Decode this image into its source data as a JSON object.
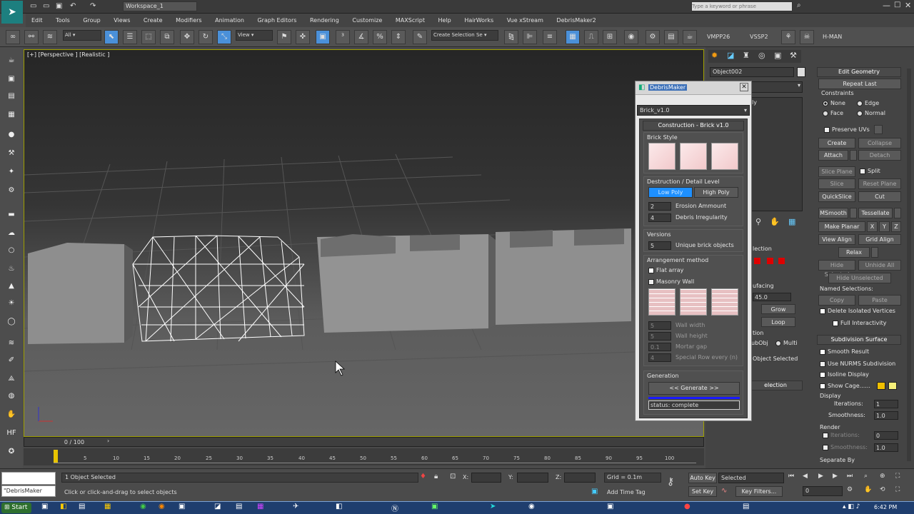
{
  "titlebar": {
    "workspace": "Workspace_1",
    "search_placeholder": "Type a keyword or phrase"
  },
  "menu": [
    "Edit",
    "Tools",
    "Group",
    "Views",
    "Create",
    "Modifiers",
    "Animation",
    "Graph Editors",
    "Rendering",
    "Customize",
    "MAXScript",
    "Help",
    "HairWorks",
    "Vue xStream",
    "DebrisMaker2"
  ],
  "toolbar": {
    "filter": "All",
    "refcoord": "View",
    "selection_set": "Create Selection Se",
    "tools": [
      "VMPP26",
      "VSSP2",
      "H-MAN"
    ]
  },
  "viewport": {
    "label": "[+] [Perspective ] [Realistic ]"
  },
  "timeline": {
    "frame": "0 / 100",
    "ticks": [
      "5",
      "10",
      "15",
      "20",
      "25",
      "30",
      "35",
      "40",
      "45",
      "50",
      "55",
      "60",
      "65",
      "70",
      "75",
      "80",
      "85",
      "90",
      "95",
      "100"
    ]
  },
  "status": {
    "maxscript": "\"DebrisMaker",
    "selected": "1 Object Selected",
    "prompt": "Click or click-and-drag to select objects",
    "x_label": "X:",
    "y_label": "Y:",
    "z_label": "Z:",
    "grid": "Grid = 0.1m",
    "add_time_tag": "Add Time Tag",
    "auto_key": "Auto Key",
    "set_key": "Set Key",
    "selected_drop": "Selected",
    "key_filters": "Key Filters...",
    "frame_value": "0"
  },
  "taskbar": {
    "start": "Start",
    "clock": "6:42 PM"
  },
  "modify_panel": {
    "object_name": "Object002",
    "stack_fragment": "ly",
    "edit_geometry": {
      "title": "Edit Geometry",
      "repeat_last": "Repeat Last",
      "constraints": "Constraints",
      "none": "None",
      "edge": "Edge",
      "face": "Face",
      "normal": "Normal",
      "preserve_uvs": "Preserve UVs",
      "create": "Create",
      "collapse": "Collapse",
      "attach": "Attach",
      "detach": "Detach",
      "slice_plane": "Slice Plane",
      "split": "Split",
      "slice": "Slice",
      "reset_plane": "Reset Plane",
      "quickslice": "QuickSlice",
      "cut": "Cut",
      "msmooth": "MSmooth",
      "tessellate": "Tessellate",
      "make_planar": "Make Planar",
      "x": "X",
      "y": "Y",
      "z": "Z",
      "view_align": "View Align",
      "grid_align": "Grid Align",
      "relax": "Relax",
      "hide_selected": "Hide Selected",
      "unhide_all": "Unhide All",
      "hide_unselected": "Hide Unselected",
      "named_selections": "Named Selections:",
      "copy": "Copy",
      "paste": "Paste",
      "delete_isolated": "Delete Isolated Vertices",
      "full_interactivity": "Full Interactivity"
    },
    "subdivision": {
      "title": "Subdivision Surface",
      "smooth_result": "Smooth Result",
      "use_nurms": "Use NURMS Subdivision",
      "isoline": "Isoline Display",
      "show_cage": "Show Cage......",
      "display": "Display",
      "iterations_label": "Iterations:",
      "iterations": "1",
      "smoothness_label": "Smoothness:",
      "smoothness": "1.0",
      "render": "Render",
      "r_iterations": "0",
      "r_smoothness": "1.0",
      "separate_by": "Separate By"
    },
    "partial": {
      "lection": "lection",
      "smoothing": "ufacing",
      "value_45": "45.0",
      "grow": "Grow",
      "loop": "Loop",
      "tion": "tion",
      "ubobj": "ubObj",
      "multi": "Multi",
      "obj_selected": "Object Selected",
      "lection2": "election"
    }
  },
  "debris": {
    "title": "DebrisMaker",
    "preset": "Brick_v1.0",
    "rollout": "Construction - Brick v1.0",
    "brick_style": "Brick Style",
    "destruction": "Destruction / Detail Level",
    "low_poly": "Low Poly",
    "high_poly": "High Poly",
    "erosion_value": "2",
    "erosion_label": "Erosion Ammount",
    "irregularity_value": "4",
    "irregularity_label": "Debris Irregularity",
    "versions": "Versions",
    "versions_value": "5",
    "versions_label": "Unique brick objects",
    "arrangement": "Arrangement method",
    "flat_array": "Flat array",
    "masonry": "Masonry Wall",
    "wall_width_value": "5",
    "wall_width": "Wall width",
    "wall_height_value": "5",
    "wall_height": "Wall height",
    "mortar_value": "0.1",
    "mortar": "Mortar gap",
    "special_value": "4",
    "special": "Special Row every (n)",
    "generation": "Generation",
    "generate": "<< Generate >>",
    "status": "status: complete"
  },
  "colors": {
    "accent": "#1e90ff",
    "viewport_border": "#a0a000",
    "cage1": "#f0c000",
    "cage2": "#f6f07a"
  }
}
